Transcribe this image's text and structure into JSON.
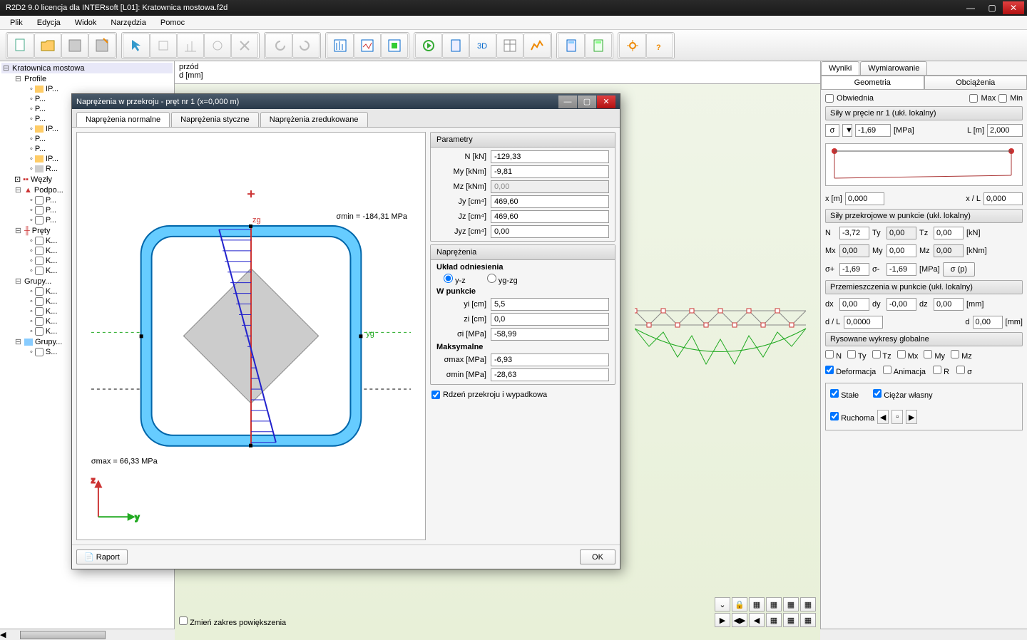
{
  "app": {
    "title": "R2D2 9.0 licencja dla INTERsoft [L01]: Kratownica mostowa.f2d"
  },
  "menu": {
    "items": [
      "Plik",
      "Edycja",
      "Widok",
      "Narzędzia",
      "Pomoc"
    ]
  },
  "tree": {
    "root": "Kratownica mostowa",
    "profile_label": "Profile",
    "items": [
      "IP...",
      "P...",
      "P...",
      "P...",
      "IP...",
      "P...",
      "P...",
      "IP...",
      "R..."
    ],
    "wezly": "Węzły",
    "podpory": "Podpo...",
    "podpory_items": [
      "P...",
      "P...",
      "P..."
    ],
    "prety": "Pręty",
    "prety_items": [
      "K...",
      "K...",
      "K...",
      "K..."
    ],
    "grupy": "Grupy...",
    "grupy_items": [
      "K...",
      "K...",
      "K...",
      "K...",
      "K..."
    ],
    "grupy2": "Grupy...",
    "grupy2_items": [
      "S..."
    ]
  },
  "canvas": {
    "header_top": "przód",
    "header_bottom": "d [mm]",
    "zoom_label": "Zmień zakres powiększenia"
  },
  "right": {
    "tab_wyniki": "Wyniki",
    "tab_wymiarowanie": "Wymiarowanie",
    "sub_geometria": "Geometria",
    "sub_obciazenia": "Obciążenia",
    "obwiednia": "Obwiednia",
    "max": "Max",
    "min": "Min",
    "sily_title": "Siły w pręcie nr 1 (ukł. lokalny)",
    "sigma_symbol": "σ",
    "sigma_val": "-1,69",
    "mpa": "[MPa]",
    "L_label": "L [m]",
    "L_val": "2,000",
    "x_label": "x [m]",
    "x_val": "0,000",
    "xL_label": "x / L",
    "xL_val": "0,000",
    "sily_przekrojowe": "Siły przekrojowe w punkcie (ukł. lokalny)",
    "N_label": "N",
    "N_val": "-3,72",
    "Ty_label": "Ty",
    "Ty_val": "0,00",
    "Tz_label": "Tz",
    "Tz_val": "0,00",
    "kN": "[kN]",
    "Mx_label": "Mx",
    "Mx_val": "0,00",
    "My_label": "My",
    "My_val": "0,00",
    "Mz_label": "Mz",
    "Mz_val": "0,00",
    "kNm": "[kNm]",
    "sigma_plus": "σ+",
    "sigma_plus_val": "-1,69",
    "sigma_minus": "σ-",
    "sigma_minus_val": "-1,69",
    "sigma_p_btn": "σ (p)",
    "przemieszczenia": "Przemieszczenia w punkcie (ukł. lokalny)",
    "dx": "dx",
    "dx_val": "0,00",
    "dy": "dy",
    "dy_val": "-0,00",
    "dz": "dz",
    "dz_val": "0,00",
    "mm": "[mm]",
    "dL": "d / L",
    "dL_val": "0,0000",
    "d_label": "d",
    "d_val": "0,00",
    "rysowane": "Rysowane wykresy globalne",
    "cb_N": "N",
    "cb_Ty": "Ty",
    "cb_Tz": "Tz",
    "cb_Mx": "Mx",
    "cb_My": "My",
    "cb_Mz": "Mz",
    "cb_def": "Deformacja",
    "cb_anim": "Animacja",
    "cb_R": "R",
    "cb_sigma": "σ",
    "cb_stale": "Stałe",
    "cb_ciezar": "Ciężar własny",
    "cb_ruchoma": "Ruchoma"
  },
  "dialog": {
    "title": "Naprężenia w przekroju - pręt nr 1 (x=0,000 m)",
    "tab1": "Naprężenia normalne",
    "tab2": "Naprężenia styczne",
    "tab3": "Naprężenia zredukowane",
    "parametry": "Parametry",
    "N": "N [kN]",
    "N_val": "-129,33",
    "My": "My [kNm]",
    "My_val": "-9,81",
    "Mz": "Mz [kNm]",
    "Mz_val": "0,00",
    "Jy": "Jy [cm⁴]",
    "Jy_val": "469,60",
    "Jz": "Jz [cm⁴]",
    "Jz_val": "469,60",
    "Jyz": "Jyz [cm⁴]",
    "Jyz_val": "0,00",
    "naprezenia": "Naprężenia",
    "uklad": "Układ odniesienia",
    "yz": "y-z",
    "ygzg": "yg-zg",
    "wpunkcie": "W punkcie",
    "yi": "yi [cm]",
    "yi_val": "5,5",
    "zi": "zi [cm]",
    "zi_val": "0,0",
    "sigma_i": "σi [MPa]",
    "sigma_i_val": "-58,99",
    "maksymalne": "Maksymalne",
    "sigma_max": "σmax [MPa]",
    "sigma_max_val": "-6,93",
    "sigma_min": "σmin [MPa]",
    "sigma_min_val": "-28,63",
    "rdzen": "Rdzeń przekroju i wypadkowa",
    "raport": "Raport",
    "ok": "OK",
    "sigma_min_draw": "σmin = -184,31 MPa",
    "sigma_max_draw": "σmax = 66,33 MPa",
    "zg_label": "zg",
    "yg_label": "yg",
    "z_axis": "z",
    "y_axis": "y"
  }
}
